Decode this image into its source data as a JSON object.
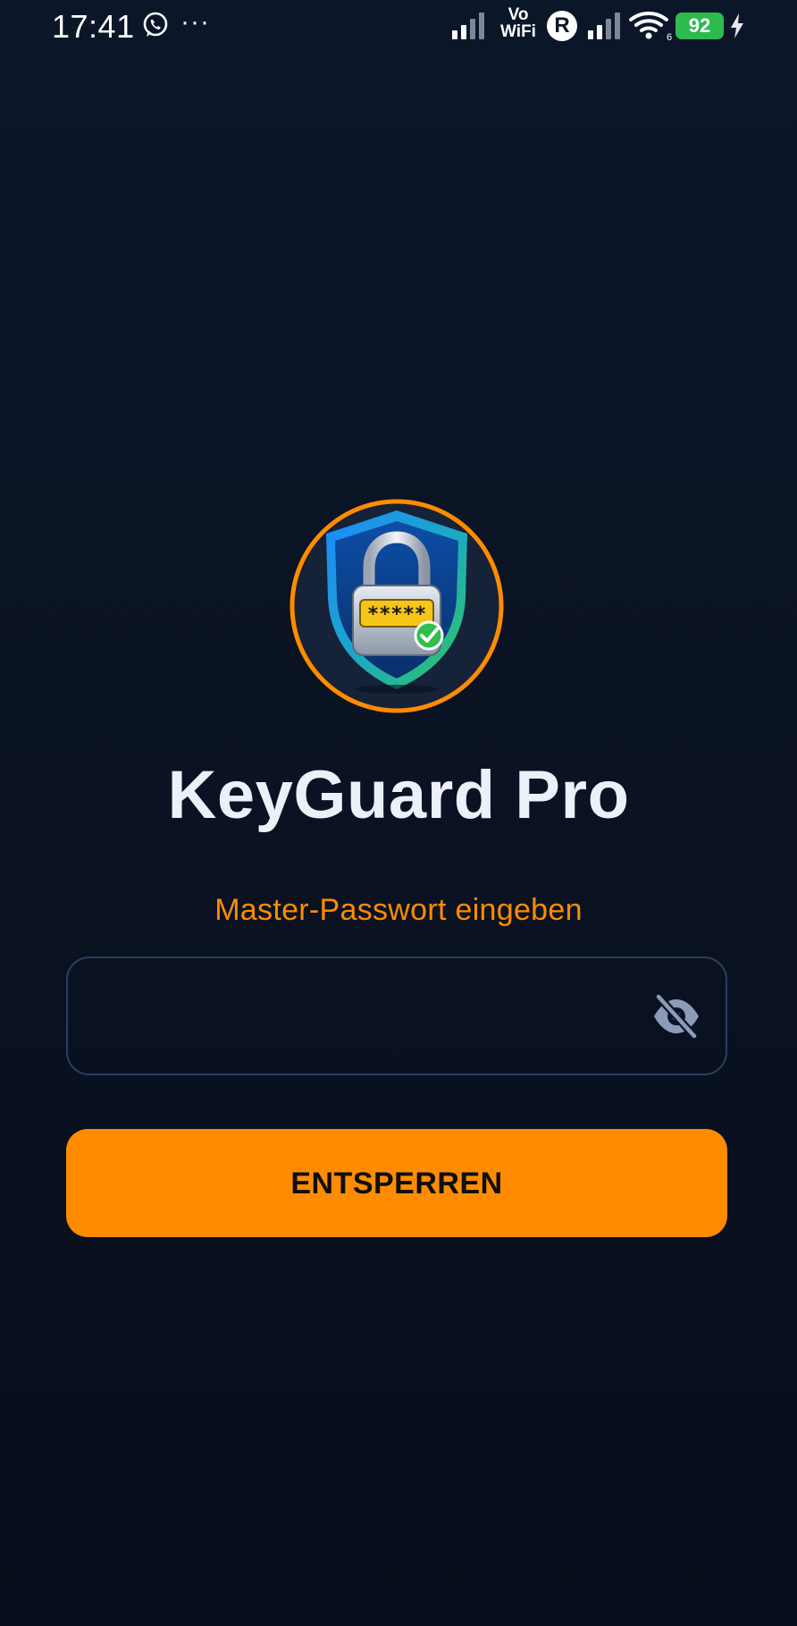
{
  "status_bar": {
    "time": "17:41",
    "notification_icons": [
      "whatsapp-icon"
    ],
    "more_indicator": "···",
    "vowifi_top": "Vo",
    "vowifi_bottom": "WiFi",
    "roaming": "R",
    "wifi_generation": "6",
    "battery_percent": "92",
    "charging": true
  },
  "app": {
    "logo_icon": "shield-lock-icon",
    "logo_password_mask": "*****",
    "title": "KeyGuard Pro"
  },
  "login": {
    "prompt": "Master-Passwort eingeben",
    "password_value": "",
    "password_placeholder": "",
    "visibility_icon": "eye-off-icon",
    "unlock_label": "ENTSPERREN"
  },
  "colors": {
    "background": "#0a1222",
    "accent": "#ff8c00",
    "title": "#ecf0f8",
    "field_border": "#2c3f5e",
    "icon": "#8c9bb8"
  }
}
